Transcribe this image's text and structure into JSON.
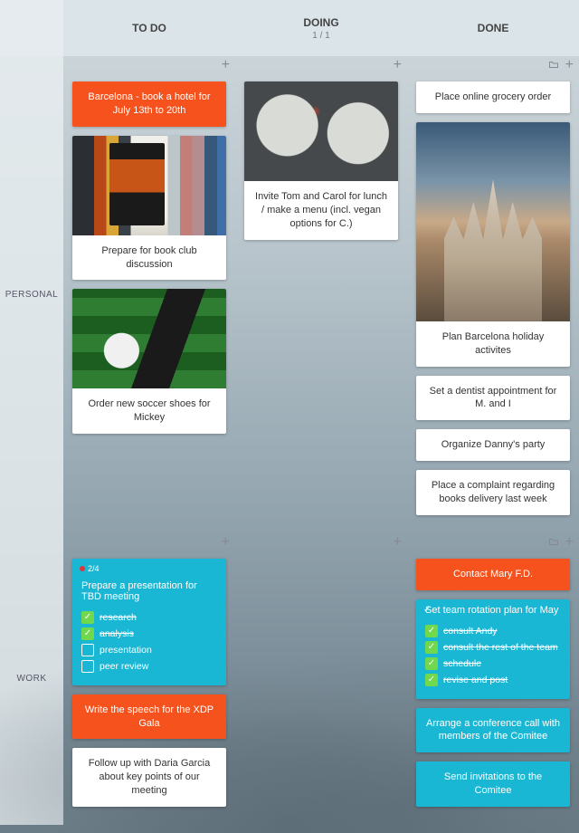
{
  "columns": {
    "todo": "TO DO",
    "doing": "DOING",
    "doing_sub": "1 / 1",
    "done": "DONE"
  },
  "rows": {
    "personal": "PERSONAL",
    "work": "WORK"
  },
  "icons": {
    "add": "+",
    "folder": "▢"
  },
  "personal": {
    "todo": [
      {
        "title": "Barcelona - book a hotel for July 13th to 20th",
        "style": "orange"
      },
      {
        "title": "Prepare for book club discussion",
        "image": "books"
      },
      {
        "title": "Order new soccer shoes for Mickey",
        "image": "soccer"
      }
    ],
    "doing": [
      {
        "title": "Invite Tom and Carol for lunch / make a menu (incl. vegan options for C.)",
        "image": "food"
      }
    ],
    "done": [
      {
        "title": "Place online grocery order"
      },
      {
        "title": "Plan Barcelona holiday activites",
        "image": "cathedral",
        "image_tall": true
      },
      {
        "title": "Set a dentist appointment for M. and I"
      },
      {
        "title": "Organize Danny's party"
      },
      {
        "title": "Place a complaint regarding books delivery last week"
      }
    ]
  },
  "work": {
    "todo": [
      {
        "title": "Prepare a presentation for TBD meeting",
        "style": "teal",
        "progress": "2/4",
        "checklist": [
          {
            "label": "research",
            "done": true
          },
          {
            "label": "analysis",
            "done": true
          },
          {
            "label": "presentation",
            "done": false
          },
          {
            "label": "peer review",
            "done": false
          }
        ]
      },
      {
        "title": "Write the speech for the XDP Gala",
        "style": "orange"
      },
      {
        "title": "Follow up with Daria Garcia about key points of our meeting"
      }
    ],
    "doing": [],
    "done": [
      {
        "title": "Contact Mary F.D.",
        "style": "orange"
      },
      {
        "title": "Set team rotation plan for May",
        "style": "teal",
        "checklist": [
          {
            "label": "consult Andy",
            "done": true
          },
          {
            "label": "consult the rest of the team",
            "done": true
          },
          {
            "label": "schedule",
            "done": true
          },
          {
            "label": "revise and post",
            "done": true
          }
        ],
        "check_indicator": true
      },
      {
        "title": "Arrange a conference call with members of the Comitee",
        "style": "teal"
      },
      {
        "title": "Send invitations to the Comitee",
        "style": "teal"
      }
    ]
  }
}
